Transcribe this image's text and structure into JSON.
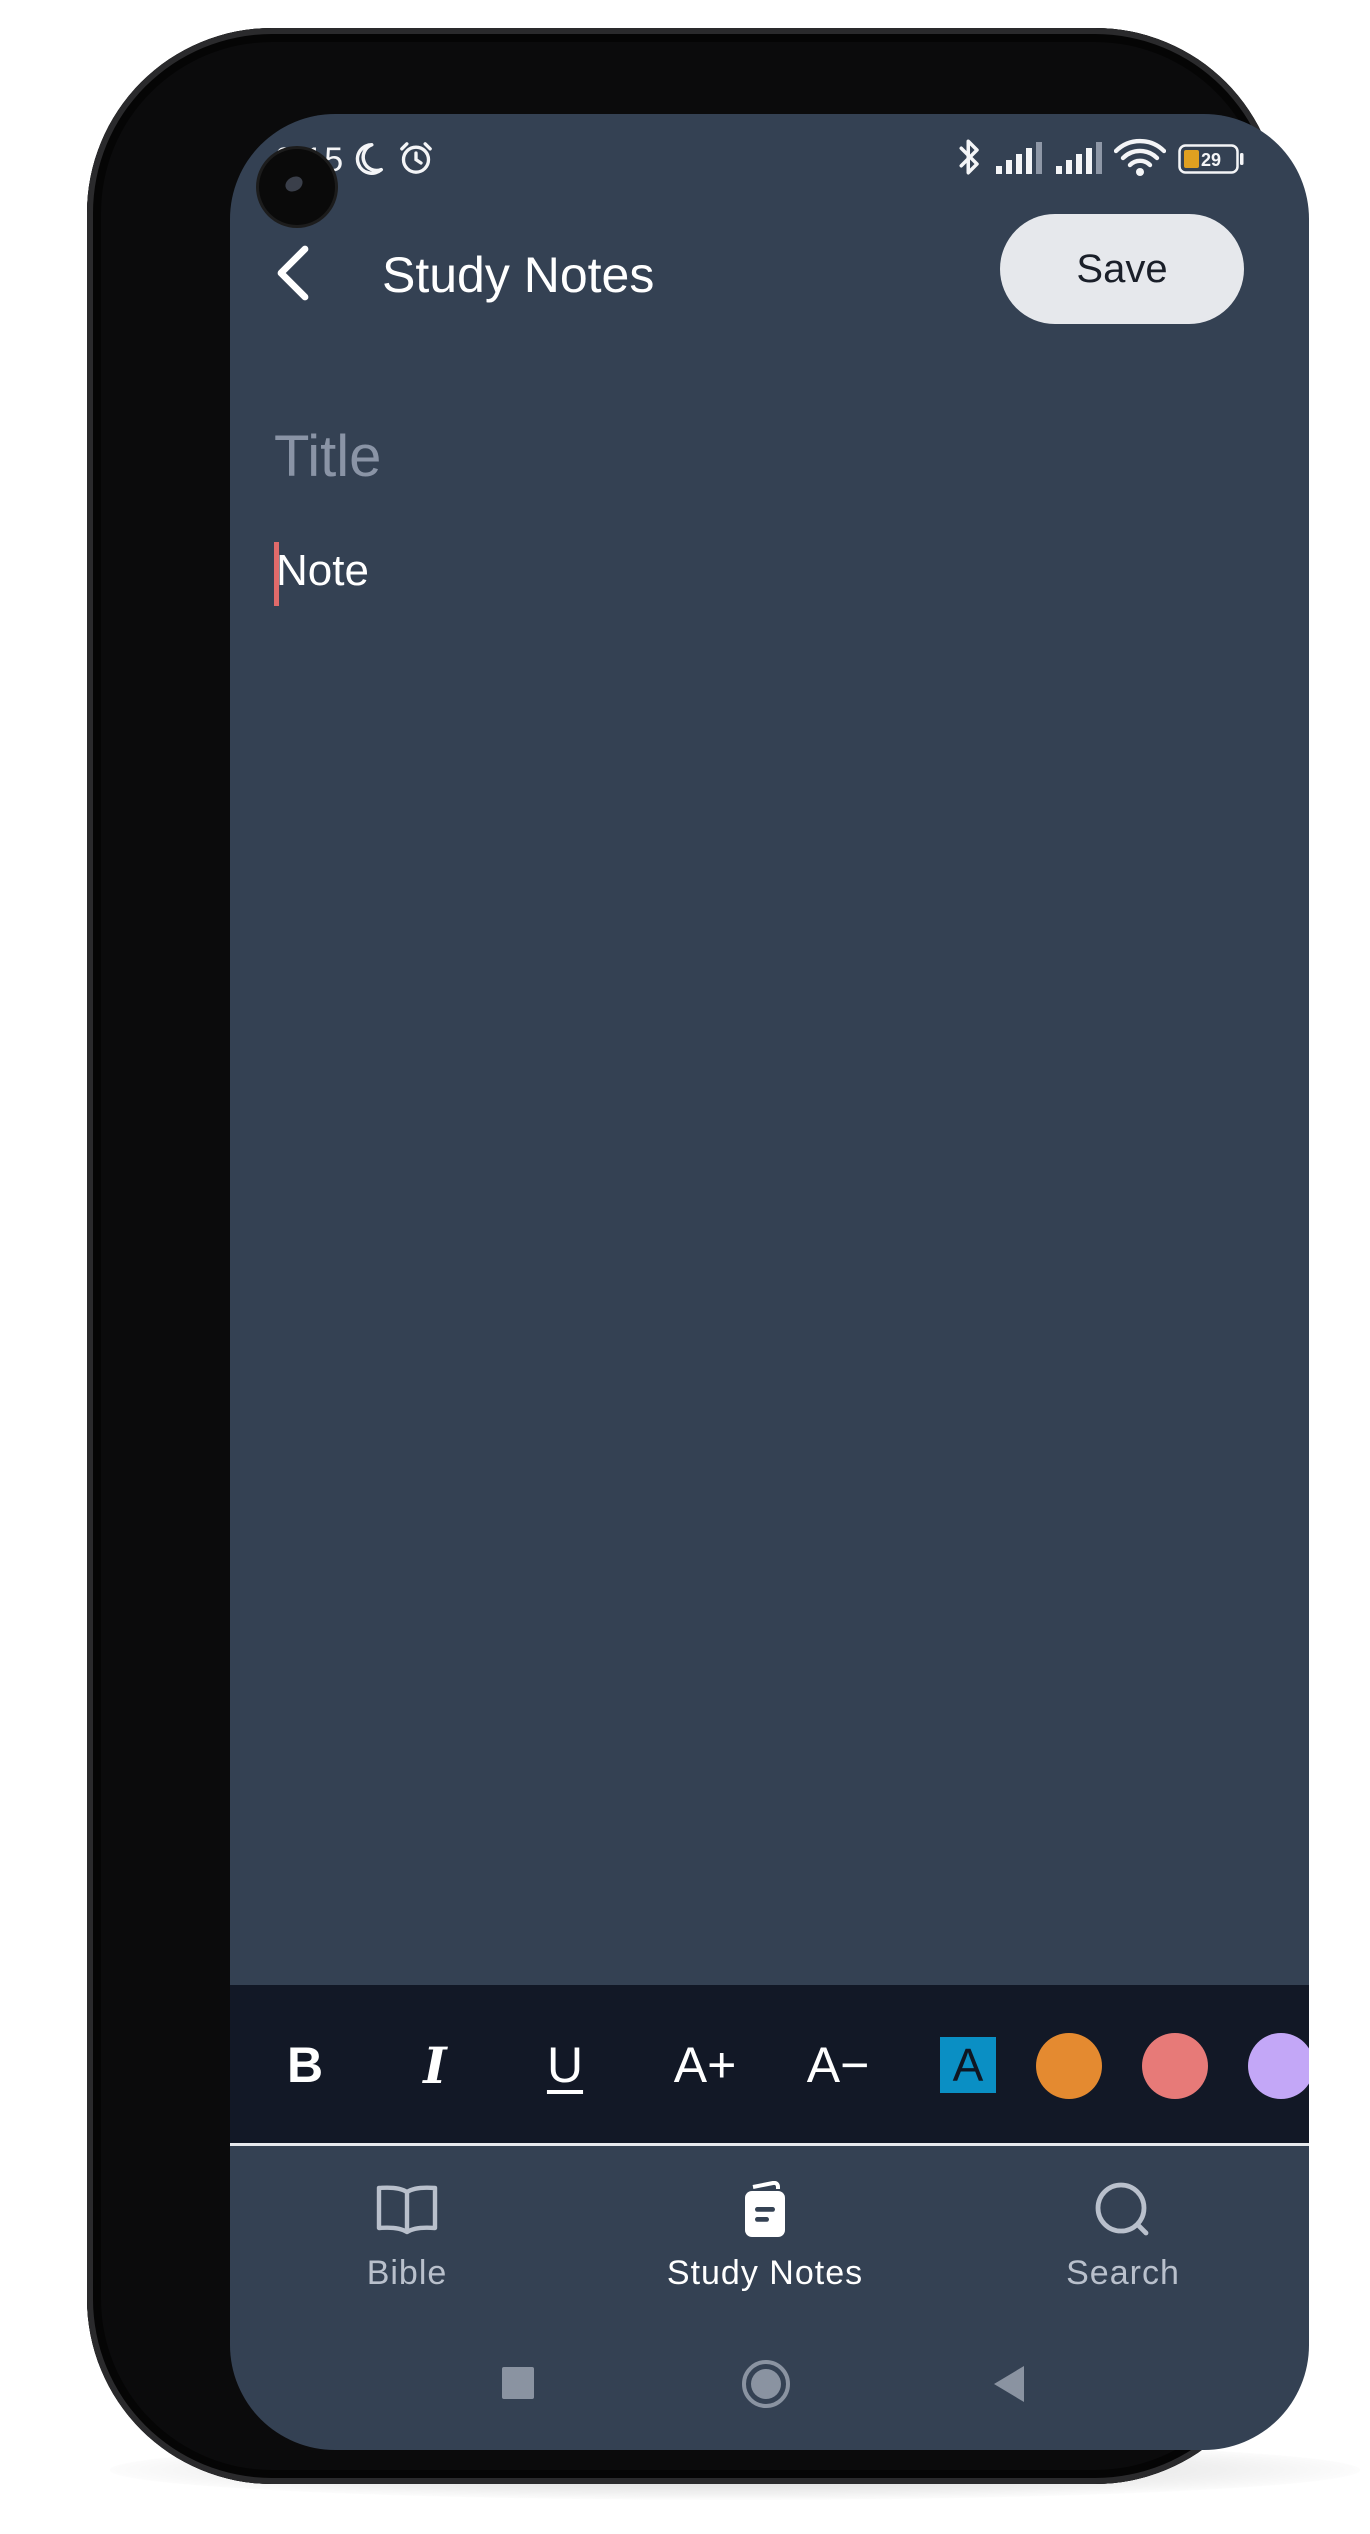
{
  "status_bar": {
    "time": "6:15",
    "battery": "29",
    "icons": [
      "moon-icon",
      "alarm-icon",
      "bluetooth-icon",
      "signal-icon",
      "signal-icon",
      "wifi-icon",
      "battery-icon"
    ]
  },
  "app_bar": {
    "back_icon": "chevron-left-icon",
    "title": "Study Notes",
    "save_label": "Save"
  },
  "editor": {
    "title_placeholder": "Title",
    "note_placeholder": "Note"
  },
  "format_toolbar": {
    "bold": "B",
    "italic": "I",
    "underline": "U",
    "increase_size": "A+",
    "decrease_size": "A−",
    "text_color": "A",
    "text_color_value": "#0a8fc4",
    "swatches": [
      "#e48a30",
      "#e77a78",
      "#c3a7f7"
    ]
  },
  "bottom_nav": {
    "items": [
      {
        "label": "Bible",
        "icon": "book-icon",
        "active": false
      },
      {
        "label": "Study Notes",
        "icon": "notes-icon",
        "active": true
      },
      {
        "label": "Search",
        "icon": "search-icon",
        "active": false
      }
    ]
  },
  "colors": {
    "background": "#344153",
    "toolbar": "#121826",
    "inactive": "#b9c0cc",
    "active": "#ffffff",
    "caret": "#e06a6a"
  }
}
